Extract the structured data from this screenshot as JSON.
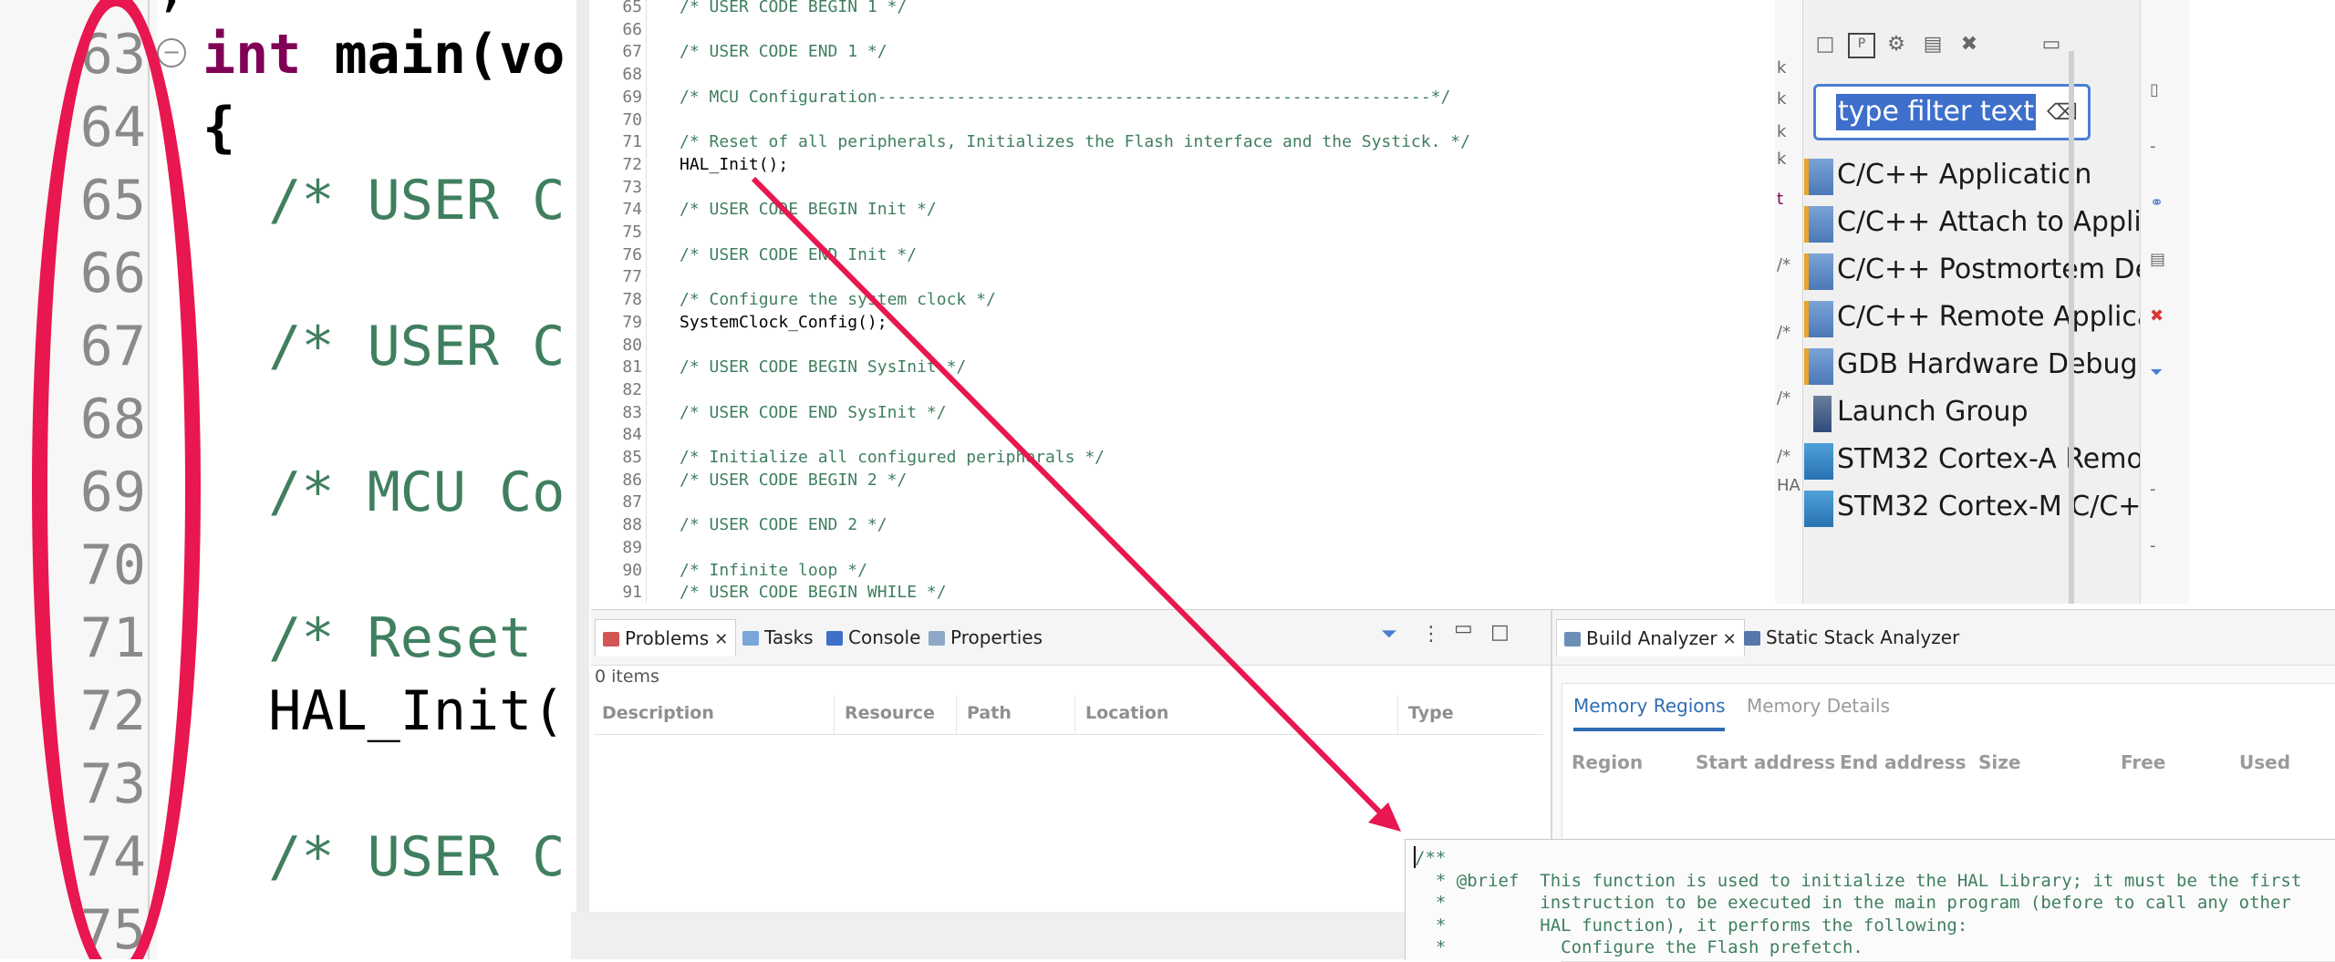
{
  "zoom": {
    "line_numbers": [
      "63",
      "64",
      "65",
      "66",
      "67",
      "68",
      "69",
      "70",
      "71",
      "72",
      "73",
      "74",
      "75"
    ],
    "code_lines": [
      {
        "kw": "int",
        "text": " main(vo"
      },
      {
        "kw": "",
        "text": "{"
      },
      {
        "cm": "  /* USER C"
      },
      {
        "cm": ""
      },
      {
        "cm": "  /* USER C"
      },
      {
        "cm": ""
      },
      {
        "cm": "  /* MCU Co"
      },
      {
        "cm": ""
      },
      {
        "cm": "  /* Reset"
      },
      {
        "code": "  HAL_Init("
      },
      {
        "cm": ""
      },
      {
        "cm": "  /* USER C"
      },
      {
        "cm": ""
      }
    ],
    "top_fragment": ";",
    "fold_symbol": "−"
  },
  "editor": {
    "line_numbers": [
      "65",
      "66",
      "67",
      "68",
      "69",
      "70",
      "71",
      "72",
      "73",
      "74",
      "75",
      "76",
      "77",
      "78",
      "79",
      "80",
      "81",
      "82",
      "83",
      "84",
      "85",
      "86",
      "87",
      "88",
      "89",
      "90",
      "91"
    ],
    "lines": [
      {
        "t": "c",
        "s": "/* USER CODE BEGIN 1 */"
      },
      {
        "t": "c",
        "s": ""
      },
      {
        "t": "c",
        "s": "/* USER CODE END 1 */"
      },
      {
        "t": "c",
        "s": ""
      },
      {
        "t": "c",
        "s": "/* MCU Configuration--------------------------------------------------------*/"
      },
      {
        "t": "c",
        "s": ""
      },
      {
        "t": "c",
        "s": "/* Reset of all peripherals, Initializes the Flash interface and the Systick. */"
      },
      {
        "t": "d",
        "s": "HAL_Init();"
      },
      {
        "t": "c",
        "s": ""
      },
      {
        "t": "c",
        "s": "/* USER CODE BEGIN Init */"
      },
      {
        "t": "c",
        "s": ""
      },
      {
        "t": "c",
        "s": "/* USER CODE END Init */"
      },
      {
        "t": "c",
        "s": ""
      },
      {
        "t": "c",
        "s": "/* Configure the system clock */"
      },
      {
        "t": "d",
        "s": "SystemClock_Config();"
      },
      {
        "t": "c",
        "s": ""
      },
      {
        "t": "c",
        "s": "/* USER CODE BEGIN SysInit */"
      },
      {
        "t": "c",
        "s": ""
      },
      {
        "t": "c",
        "s": "/* USER CODE END SysInit */"
      },
      {
        "t": "c",
        "s": ""
      },
      {
        "t": "c",
        "s": "/* Initialize all configured peripherals */"
      },
      {
        "t": "c",
        "s": "/* USER CODE BEGIN 2 */"
      },
      {
        "t": "c",
        "s": ""
      },
      {
        "t": "c",
        "s": "/* USER CODE END 2 */"
      },
      {
        "t": "c",
        "s": ""
      },
      {
        "t": "c",
        "s": "/* Infinite loop */"
      },
      {
        "t": "c",
        "s": "/* USER CODE BEGIN WHILE */"
      }
    ]
  },
  "launch_panel": {
    "filter_placeholder": "type filter text",
    "items": [
      "C/C++ Application",
      "C/C++ Attach to Applic",
      "C/C++ Postmortem De",
      "C/C++ Remote Applica",
      "GDB Hardware Debug",
      "Launch Group",
      "STM32 Cortex-A Remo",
      "STM32 Cortex-M C/C+"
    ],
    "side_marks": [
      "k",
      "k",
      "k",
      "k",
      "t",
      "/*",
      "/*",
      "/*",
      "/*",
      "HA"
    ]
  },
  "problems": {
    "tabs": [
      "Problems",
      "Tasks",
      "Console",
      "Properties"
    ],
    "count": "0 items",
    "columns": [
      "Description",
      "Resource",
      "Path",
      "Location",
      "Type"
    ]
  },
  "build_analyzer": {
    "tabs": [
      "Build Analyzer",
      "Static Stack Analyzer"
    ],
    "inner_tabs": [
      "Memory Regions",
      "Memory Details"
    ],
    "columns": [
      "Region",
      "Start address",
      "End address",
      "Size",
      "Free",
      "Used"
    ]
  },
  "doc_popup": {
    "lines": [
      "/**",
      "  * @brief  This function is used to initialize the HAL Library; it must be the first",
      "  *         instruction to be executed in the main program (before to call any other",
      "  *         HAL function), it performs the following:",
      "  *           Configure the Flash prefetch."
    ]
  },
  "annotation_colors": {
    "ellipse": "#e8174f",
    "arrow": "#e8174f"
  }
}
